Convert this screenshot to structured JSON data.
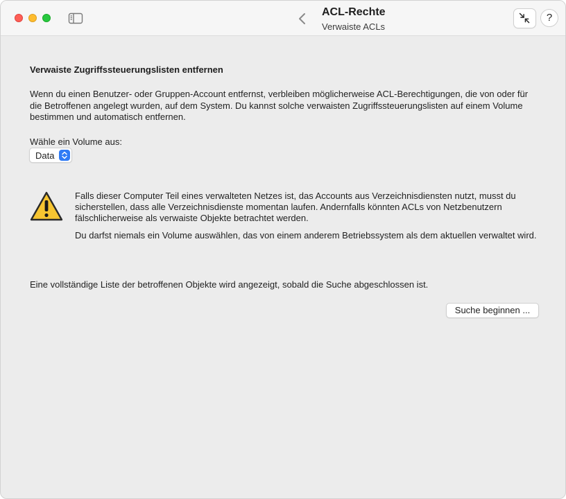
{
  "window": {
    "title": "ACL-Rechte",
    "subtitle": "Verwaiste ACLs",
    "help_label": "?"
  },
  "toolbar": {
    "icons": [
      "sidebar-toggle-icon",
      "chevron-left-icon",
      "shrink-arrows-icon"
    ]
  },
  "content": {
    "heading": "Verwaiste Zugriffssteuerungslisten entfernen",
    "description": "Wenn du einen Benutzer- oder Gruppen-Account entfernst, verbleiben möglicherweise ACL-Berechtigungen, die von oder für die Betroffenen angelegt wurden, auf dem System. Du kannst solche verwaisten Zugriffssteuerungslisten auf einem Volume bestimmen und automatisch entfernen.",
    "volume_label": "Wähle ein Volume aus:",
    "volume_selected": "Data",
    "warning_icon": "warning-triangle-icon",
    "warning_1": "Falls dieser Computer Teil eines verwalteten Netzes ist, das Accounts aus Verzeichnisdiensten nutzt, musst du sicherstellen, dass alle Verzeichnisdienste momentan laufen. Andernfalls könnten ACLs von Netzbenutzern fälschlicherweise als verwaiste Objekte betrachtet werden.",
    "warning_2": "Du darfst niemals ein Volume auswählen, das von einem anderem Betriebssystem als dem aktuellen verwaltet wird.",
    "footer_note": "Eine vollständige Liste der betroffenen Objekte wird angezeigt, sobald die Suche abgeschlossen ist.",
    "start_button": "Suche beginnen ..."
  },
  "colors": {
    "close": "#fe5f57",
    "minimize": "#febc2e",
    "zoom": "#28c840",
    "accent": "#2f7bf5",
    "warning": "#f7c531"
  }
}
